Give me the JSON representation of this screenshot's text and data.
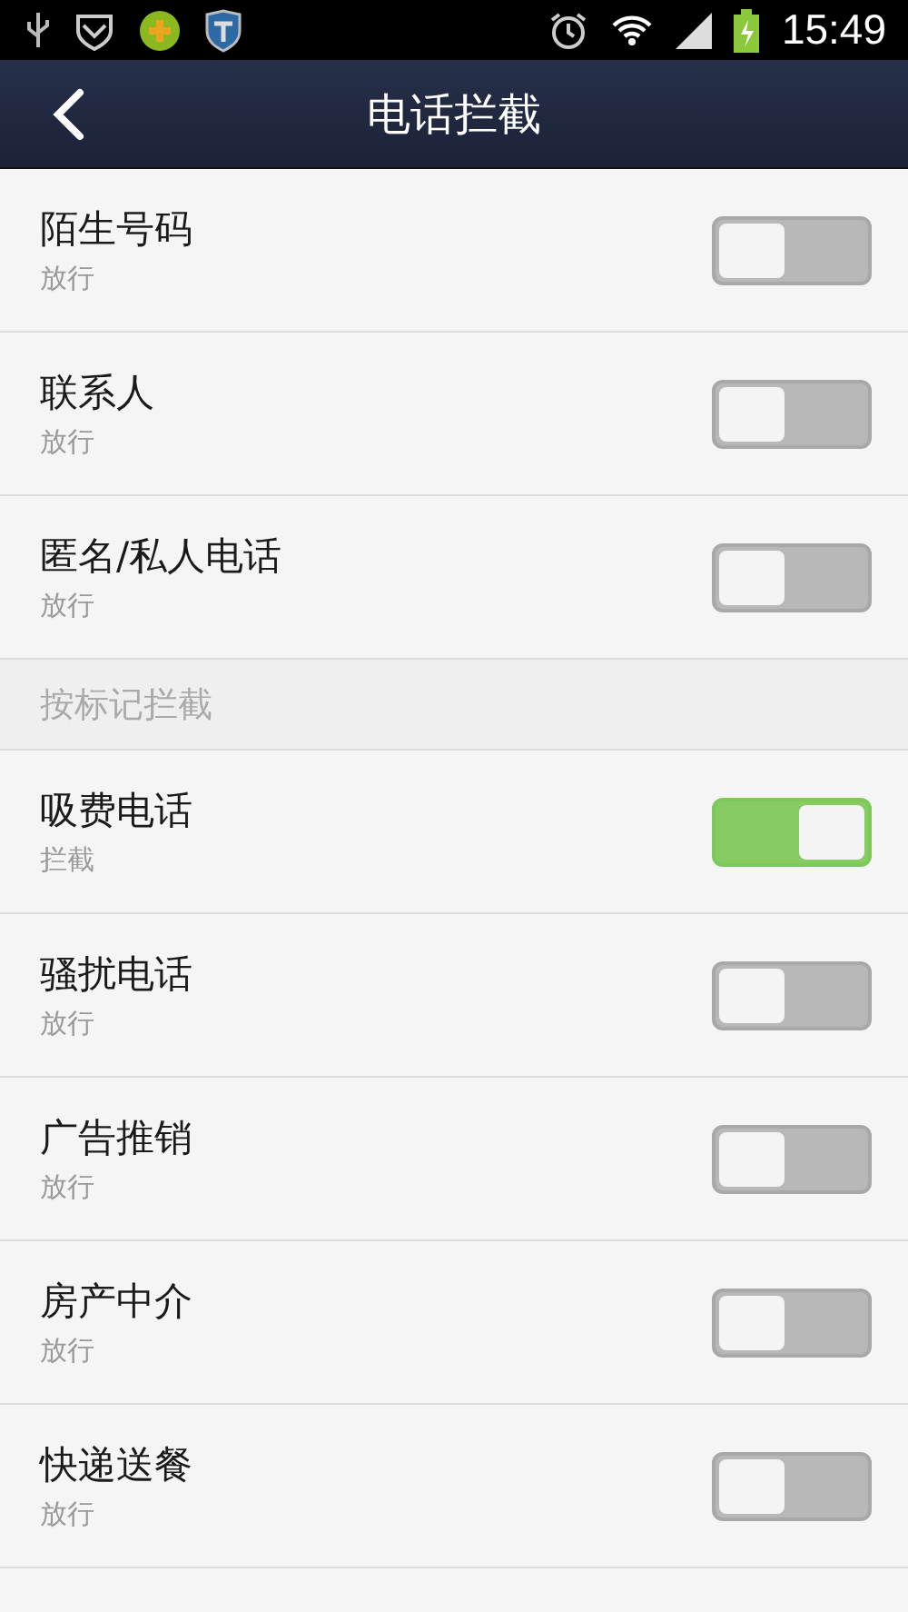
{
  "status_bar": {
    "time": "15:49"
  },
  "header": {
    "title": "电话拦截"
  },
  "items": [
    {
      "kind": "toggle",
      "label": "陌生号码",
      "status": "放行",
      "on": false
    },
    {
      "kind": "toggle",
      "label": "联系人",
      "status": "放行",
      "on": false
    },
    {
      "kind": "toggle",
      "label": "匿名/私人电话",
      "status": "放行",
      "on": false
    },
    {
      "kind": "section",
      "label": "按标记拦截"
    },
    {
      "kind": "toggle",
      "label": "吸费电话",
      "status": "拦截",
      "on": true
    },
    {
      "kind": "toggle",
      "label": "骚扰电话",
      "status": "放行",
      "on": false
    },
    {
      "kind": "toggle",
      "label": "广告推销",
      "status": "放行",
      "on": false
    },
    {
      "kind": "toggle",
      "label": "房产中介",
      "status": "放行",
      "on": false
    },
    {
      "kind": "toggle",
      "label": "快递送餐",
      "status": "放行",
      "on": false
    }
  ]
}
